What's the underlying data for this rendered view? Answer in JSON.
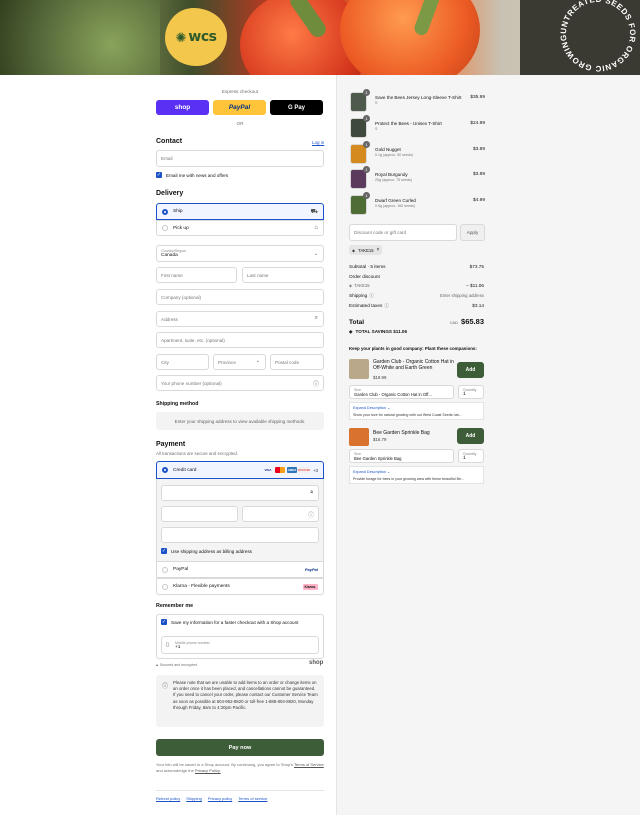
{
  "banner": {
    "logo_text": "wcs",
    "seal_text": "UNTREATED SEEDS FOR ORGANIC GROWING",
    "colors": {
      "logo_bg": "#f3c74b",
      "logo_fg": "#2f5a2a"
    }
  },
  "express": {
    "label": "Express checkout",
    "shop": "shop",
    "paypal": "PayPal",
    "gpay": "G Pay",
    "or": "OR"
  },
  "contact": {
    "title": "Contact",
    "login": "Log in",
    "email_placeholder": "Email",
    "news": "Email me with news and offers"
  },
  "delivery": {
    "title": "Delivery",
    "ship": "Ship",
    "pickup": "Pick up",
    "country_label": "Country/Region",
    "country": "Canada",
    "first": "First name",
    "last": "Last name",
    "company": "Company (optional)",
    "address": "Address",
    "apartment": "Apartment, suite, etc. (optional)",
    "city": "City",
    "province": "Province",
    "postal": "Postal code",
    "phone": "Your phone number (optional)"
  },
  "shipping_method": {
    "title": "Shipping method",
    "note": "Enter your shipping address to view available shipping methods."
  },
  "payment": {
    "title": "Payment",
    "subtitle": "All transactions are secure and encrypted.",
    "credit_card": "Credit card",
    "more_cards": "+3",
    "card_logos": [
      "VISA",
      "MC",
      "AMEX",
      "DISCOVER"
    ],
    "billing_same": "Use shipping address as billing address",
    "paypal": "PayPal",
    "paypal_logo": "PayPal",
    "klarna": "Klarna - Flexible payments",
    "klarna_logo": "Klarna."
  },
  "remember": {
    "title": "Remember me",
    "save": "Save my information for a faster checkout with a Shop account",
    "mobile_label": "Mobile phone number",
    "mobile_value": "+1",
    "secure": "Secured and encrypted",
    "shop_logo": "shop"
  },
  "notice": "Please note that we are unable to add items to an order or change items on an order once it has been placed, and cancellations cannot be guaranteed. If you need to cancel your order, please contact our Customer Service Team as soon as possible at 604-952-8820 or toll-free 1-888-804-8820, Monday through Friday, 8am to 4:30pm Pacific.",
  "pay_now": "Pay now",
  "terms": {
    "text": "Your info will be saved to a Shop account. By continuing, you agree to Shop's",
    "tos": "Terms of Service",
    "and": "and acknowledge the",
    "privacy": "Privacy Policy."
  },
  "footer_links": [
    "Refund policy",
    "Shipping",
    "Privacy policy",
    "Terms of service"
  ],
  "cart": {
    "items": [
      {
        "name": "Save the Bees Jersey Long-Sleeve T-Shirt",
        "variant": "S",
        "qty": "1",
        "price": "$35.99",
        "color": "#4e5a4c"
      },
      {
        "name": "Protect the Bees - Unisex T-Shirt",
        "variant": "S",
        "qty": "1",
        "price": "$24.99",
        "color": "#3f4a3c"
      },
      {
        "name": "Gold Nugget",
        "variant": "0.1g (approx. 50 seeds)",
        "qty": "1",
        "price": "$3.89",
        "color": "#d48a1f"
      },
      {
        "name": "Royal Burgundy",
        "variant": "25g (approx. 75 seeds)",
        "qty": "1",
        "price": "$3.89",
        "color": "#5b3a5e"
      },
      {
        "name": "Dwarf Green Curled",
        "variant": "0.5g (approx. 160 seeds)",
        "qty": "1",
        "price": "$4.99",
        "color": "#4e6e35"
      }
    ],
    "discount_placeholder": "Discount code or gift card",
    "apply": "Apply",
    "code": "TAKE15",
    "subtotal_label": "Subtotal · 5 items",
    "subtotal": "$73.75",
    "order_discount_label": "Order discount",
    "discount_code": "TAKE15",
    "discount_value": "− $11.06",
    "shipping_label": "Shipping",
    "shipping_value": "Enter shipping address",
    "taxes_label": "Estimated taxes",
    "taxes_value": "$3.14",
    "total_label": "Total",
    "currency": "CAD",
    "total": "$65.83",
    "savings": "TOTAL SAVINGS  $11.06"
  },
  "recommend": {
    "title": "Keep your plants in good company: Plant these companions:",
    "items": [
      {
        "name": "Garden Club - Organic Cotton Hat in Off-White and Earth Green",
        "price": "$19.99",
        "add": "Add",
        "size_label": "Size",
        "size_value": "Garden Club - Organic Cotton Hat in Off...",
        "qty_label": "Quantity",
        "qty_value": "1",
        "expand": "Expand Description",
        "desc": "Show your love for natural growing with our West Coast Seeds hat...",
        "color": "#b9a98a"
      },
      {
        "name": "Bee Garden Sprinkle Bag",
        "price": "$16.79",
        "add": "Add",
        "size_label": "Size",
        "size_value": "Bee Garden Sprinkle Bag",
        "qty_label": "Quantity",
        "qty_value": "1",
        "expand": "Expand Description",
        "desc": "Provide forage for bees in your growing area with these beautiful Be...",
        "color": "#d9722f"
      }
    ]
  }
}
